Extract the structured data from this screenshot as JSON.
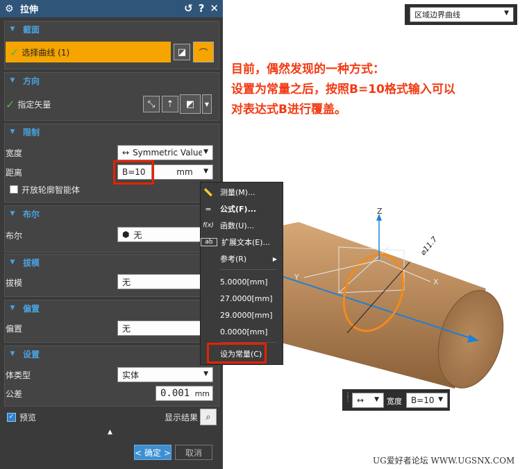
{
  "dialog": {
    "title": "拉伸",
    "title_buttons": [
      "↺",
      "?",
      "✕"
    ]
  },
  "sections": {
    "section": {
      "title": "截面",
      "select_curve": "选择曲线 (1)"
    },
    "direction": {
      "title": "方向",
      "specify_vector": "指定矢量"
    },
    "limits": {
      "title": "限制",
      "width_label": "宽度",
      "width_value": "Symmetric Value",
      "distance_label": "距离",
      "distance_value": "B=10",
      "distance_unit": "mm",
      "open_profile": "开放轮廓智能体"
    },
    "boolean": {
      "title": "布尔",
      "label": "布尔",
      "value": "无"
    },
    "draft": {
      "title": "拔模",
      "label": "拔模",
      "value": "无"
    },
    "offset": {
      "title": "偏置",
      "label": "偏置",
      "value": "无"
    },
    "settings": {
      "title": "设置",
      "body_type_label": "体类型",
      "body_type_value": "实体",
      "tolerance_label": "公差",
      "tolerance_value": "0.001",
      "tolerance_unit": "mm"
    }
  },
  "footer": {
    "preview": "预览",
    "show_result": "显示结果",
    "ok": "< 确定 >",
    "cancel": "取消"
  },
  "context_menu": {
    "items": [
      {
        "icon": "ruler-icon",
        "label": "测量(M)..."
      },
      {
        "icon": "equals-icon",
        "label": "公式(F)..."
      },
      {
        "icon": "function-icon",
        "label": "函数(U)..."
      },
      {
        "icon": "text-icon",
        "label": "扩展文本(E)..."
      },
      {
        "icon": "",
        "label": "参考(R)"
      }
    ],
    "recent_values": [
      "5.0000[mm]",
      "27.0000[mm]",
      "29.0000[mm]",
      "0.0000[mm]"
    ],
    "make_constant": "设为常量(C)"
  },
  "annotation": {
    "line1": "目前，偶然发现的一种方式：",
    "line2": "设置为常量之后，按照B=10格式输入可以",
    "line3": "对表达式B进行覆盖。"
  },
  "top_selector": {
    "value": "区域边界曲线"
  },
  "mini_toolbar": {
    "label": "宽度",
    "value": "B=10"
  },
  "viewport": {
    "axis_z": "Z",
    "axis_x": "X",
    "axis_y": "Y",
    "dim": "⌀11.7",
    "cylinder_color": "#b5875a",
    "axis_color": "#1f7fd6",
    "ring_color": "#f28b1a"
  },
  "watermark": "UG爱好者论坛 WWW.UGSNX.COM",
  "colors": {
    "accent": "#4aa3df",
    "highlight": "#f5a400",
    "annotation": "#f23a12",
    "title_bar": "#2f5679"
  }
}
